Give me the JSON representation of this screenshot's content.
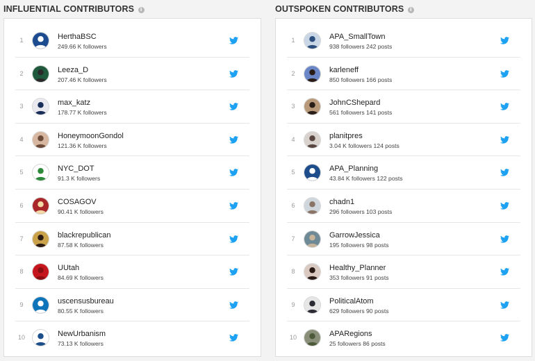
{
  "influential": {
    "title": "INFLUENTIAL CONTRIBUTORS",
    "rows": [
      {
        "rank": "1",
        "name": "HerthaBSC",
        "meta": "249.66 K followers",
        "avatar_bg": "#1d4b8f",
        "avatar_fg": "#ffffff"
      },
      {
        "rank": "2",
        "name": "Leeza_D",
        "meta": "207.46 K followers",
        "avatar_bg": "#1f5a3c",
        "avatar_fg": "#2a2a2a"
      },
      {
        "rank": "3",
        "name": "max_katz",
        "meta": "178.77 K followers",
        "avatar_bg": "#e9e9ef",
        "avatar_fg": "#1a2e5a"
      },
      {
        "rank": "4",
        "name": "HoneymoonGondol",
        "meta": "121.36 K followers",
        "avatar_bg": "#d8b7a0",
        "avatar_fg": "#6b4a3a"
      },
      {
        "rank": "5",
        "name": "NYC_DOT",
        "meta": "91.3 K followers",
        "avatar_bg": "#ffffff",
        "avatar_fg": "#2d8a3b"
      },
      {
        "rank": "6",
        "name": "COSAGOV",
        "meta": "90.41 K followers",
        "avatar_bg": "#a8252a",
        "avatar_fg": "#f2d9a6"
      },
      {
        "rank": "7",
        "name": "blackrepublican",
        "meta": "87.58 K followers",
        "avatar_bg": "#c9a24a",
        "avatar_fg": "#2a1a12"
      },
      {
        "rank": "8",
        "name": "UUtah",
        "meta": "84.69 K followers",
        "avatar_bg": "#c4161c",
        "avatar_fg": "#8a0e12"
      },
      {
        "rank": "9",
        "name": "uscensusbureau",
        "meta": "80.55 K followers",
        "avatar_bg": "#0d74b9",
        "avatar_fg": "#ffffff"
      },
      {
        "rank": "10",
        "name": "NewUrbanism",
        "meta": "73.13 K followers",
        "avatar_bg": "#ffffff",
        "avatar_fg": "#1c4f8a"
      }
    ]
  },
  "outspoken": {
    "title": "OUTSPOKEN CONTRIBUTORS",
    "rows": [
      {
        "rank": "1",
        "name": "APA_SmallTown",
        "meta": "938 followers 242 posts",
        "avatar_bg": "#c8d6e6",
        "avatar_fg": "#2b4e7d"
      },
      {
        "rank": "2",
        "name": "karleneff",
        "meta": "850 followers 166 posts",
        "avatar_bg": "#6a86c6",
        "avatar_fg": "#2a1c16"
      },
      {
        "rank": "3",
        "name": "JohnCShepard",
        "meta": "561 followers 141 posts",
        "avatar_bg": "#b89a7a",
        "avatar_fg": "#2a1e18"
      },
      {
        "rank": "4",
        "name": "planitpres",
        "meta": "3.04 K followers 124 posts",
        "avatar_bg": "#d9d2cc",
        "avatar_fg": "#5a4640"
      },
      {
        "rank": "5",
        "name": "APA_Planning",
        "meta": "43.84 K followers 122 posts",
        "avatar_bg": "#1d4d8a",
        "avatar_fg": "#ffffff"
      },
      {
        "rank": "6",
        "name": "chadn1",
        "meta": "296 followers 103 posts",
        "avatar_bg": "#cfd6dc",
        "avatar_fg": "#8a7466"
      },
      {
        "rank": "7",
        "name": "GarrowJessica",
        "meta": "195 followers 98 posts",
        "avatar_bg": "#6d8a96",
        "avatar_fg": "#c7b49a"
      },
      {
        "rank": "8",
        "name": "Healthy_Planner",
        "meta": "353 followers 91 posts",
        "avatar_bg": "#d9c9c0",
        "avatar_fg": "#2a1a16"
      },
      {
        "rank": "9",
        "name": "PoliticalAtom",
        "meta": "629 followers 90 posts",
        "avatar_bg": "#e6e6e6",
        "avatar_fg": "#2b2b33"
      },
      {
        "rank": "10",
        "name": "APARegions",
        "meta": "25 followers 86 posts",
        "avatar_bg": "#8a8f7a",
        "avatar_fg": "#4d5a3a"
      }
    ]
  },
  "colors": {
    "twitter": "#1da1f2",
    "rank": "#999999",
    "divider": "#e6e6e6"
  },
  "icons": {
    "info": "info-icon",
    "twitter": "twitter-bird-icon"
  }
}
